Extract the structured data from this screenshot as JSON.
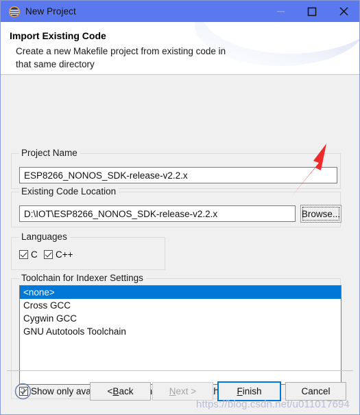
{
  "window": {
    "title": "New Project",
    "icon": "eclipse-icon",
    "controls": {
      "minimize": "minimize-icon",
      "maximize": "maximize-icon",
      "close": "close-icon"
    }
  },
  "header": {
    "title": "Import Existing Code",
    "description": "Create a new Makefile project from existing code in that same directory"
  },
  "project_name": {
    "group_label": "Project Name",
    "value": "ESP8266_NONOS_SDK-release-v2.2.x",
    "placeholder": ""
  },
  "existing_code_location": {
    "group_label": "Existing Code Location",
    "value": "D:\\IOT\\ESP8266_NONOS_SDK-release-v2.2.x",
    "placeholder": "",
    "browse_label": "Browse..."
  },
  "languages": {
    "group_label": "Languages",
    "options": [
      {
        "label": "C",
        "checked": true
      },
      {
        "label": "C++",
        "checked": true
      }
    ]
  },
  "toolchain": {
    "group_label": "Toolchain for Indexer Settings",
    "items": [
      {
        "label": "<none>",
        "selected": true
      },
      {
        "label": "Cross GCC",
        "selected": false
      },
      {
        "label": "Cygwin GCC",
        "selected": false
      },
      {
        "label": "GNU Autotools Toolchain",
        "selected": false
      }
    ],
    "show_only_available": {
      "label": "Show only available toolchains that support this platform",
      "checked": true
    }
  },
  "footer": {
    "help": "help-icon",
    "buttons": [
      {
        "name": "back",
        "prefix": "< ",
        "mnemonic": "B",
        "suffix": "ack",
        "state": "enabled"
      },
      {
        "name": "next",
        "prefix": "",
        "mnemonic": "N",
        "suffix": "ext >",
        "state": "disabled"
      },
      {
        "name": "finish",
        "prefix": "",
        "mnemonic": "F",
        "suffix": "inish",
        "state": "default"
      },
      {
        "name": "cancel",
        "prefix": "",
        "mnemonic": "",
        "suffix": "Cancel",
        "state": "enabled"
      }
    ]
  },
  "annotations": {
    "arrow": "red-arrow-annotation",
    "watermark": "https://blog.csdn.net/u011017694"
  },
  "colors": {
    "titlebar": "#5b79ee",
    "dialog_bg": "#f0f0f0",
    "selection": "#0078d7",
    "accent": "#0078d7",
    "arrow": "#ee2b2b",
    "watermark": "#b9bdd6"
  }
}
